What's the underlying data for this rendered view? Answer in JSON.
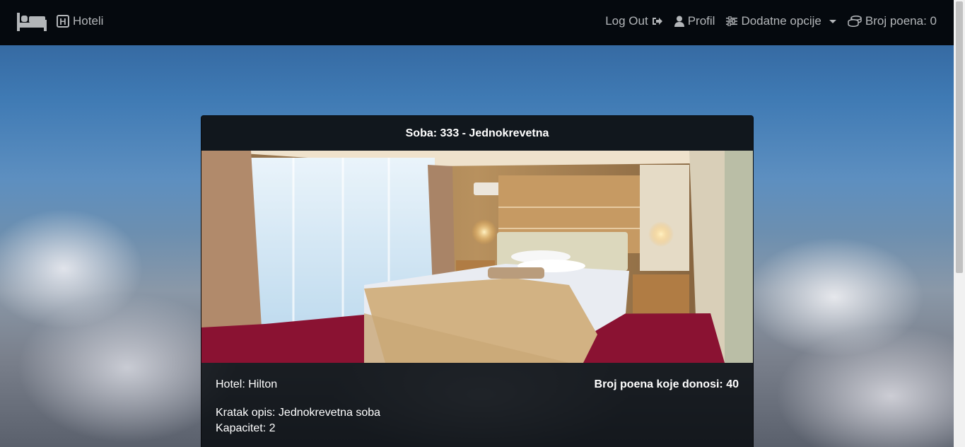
{
  "navbar": {
    "brand_icon": "bed-icon",
    "hotels_label": "Hoteli",
    "logout_label": "Log Out",
    "profile_label": "Profil",
    "options_label": "Dodatne opcije",
    "points_label": "Broj poena: 0"
  },
  "card": {
    "title": "Soba: 333 - Jednokrevetna",
    "hotel": "Hotel: Hilton",
    "points_awarded": "Broj poena koje donosi: 40",
    "description": "Kratak opis: Jednokrevetna soba",
    "capacity": "Kapacitet: 2"
  }
}
